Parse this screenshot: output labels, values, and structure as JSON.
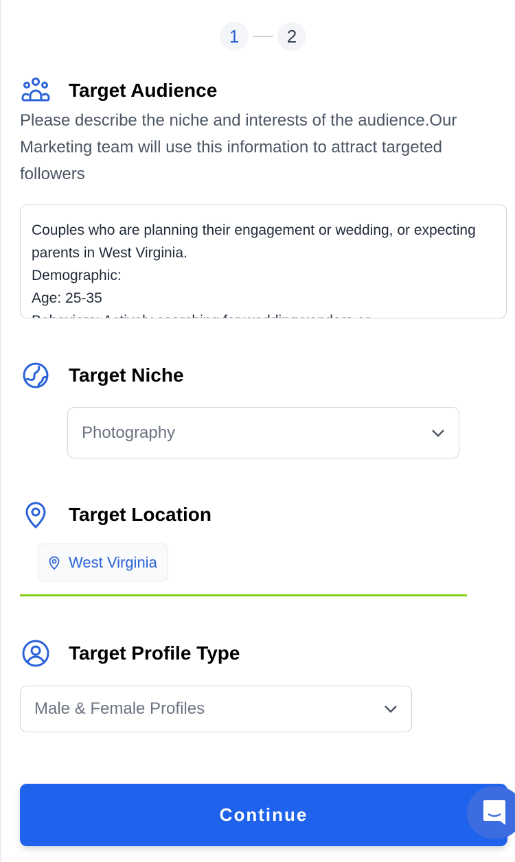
{
  "stepper": {
    "steps": [
      "1",
      "2"
    ],
    "current": 1
  },
  "audience": {
    "title": "Target Audience",
    "icon": "users-icon",
    "description": "Please describe the niche and interests of the audience.Our Marketing team will use this information to attract targeted followers",
    "value": "Couples who are planning their engagement or wedding, or expecting parents in West Virginia.\nDemographic:\nAge: 25-35\nBehaviors: Actively searching for wedding vendors or"
  },
  "niche": {
    "title": "Target Niche",
    "icon": "globe-icon",
    "selected": "Photography"
  },
  "location": {
    "title": "Target Location",
    "icon": "map-pin-icon",
    "chips": [
      "West Virginia"
    ]
  },
  "profile": {
    "title": "Target Profile Type",
    "icon": "user-circle-icon",
    "selected": "Male & Female Profiles"
  },
  "continue_label": "Continue",
  "colors": {
    "accent": "#1f63ec",
    "divider": "#84cc16",
    "icon": "#2a62d9"
  }
}
